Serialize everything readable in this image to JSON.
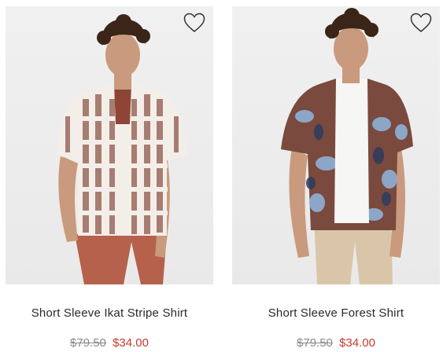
{
  "products": [
    {
      "name": "Short Sleeve Ikat Stripe Shirt",
      "original_price": "$79.50",
      "sale_price": "$34.00",
      "wishlist_icon": "heart-outline-icon"
    },
    {
      "name": "Short Sleeve Forest Shirt",
      "original_price": "$79.50",
      "sale_price": "$34.00",
      "wishlist_icon": "heart-outline-icon"
    }
  ],
  "colors": {
    "sale_price": "#c8392b",
    "original_price": "#8a8a8a",
    "image_background": "#ececec"
  }
}
